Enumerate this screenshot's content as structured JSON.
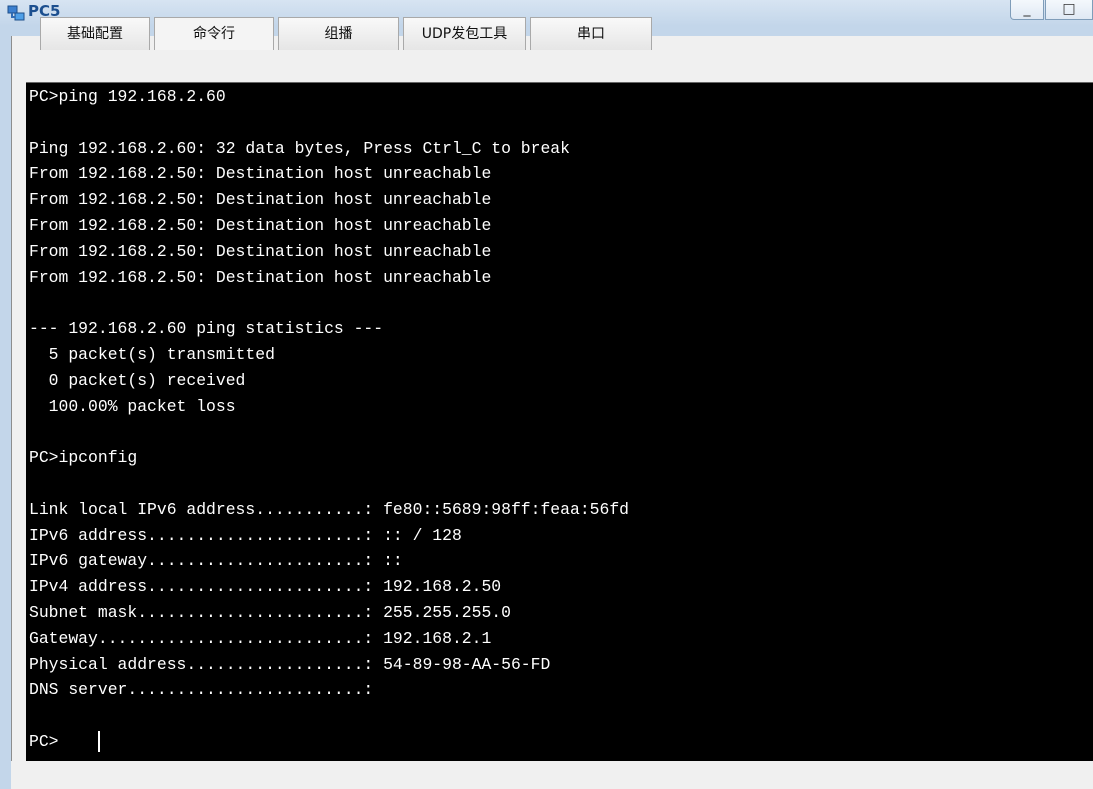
{
  "window": {
    "title": "PC5",
    "minimize_label": "_",
    "maximize_label": "□"
  },
  "tabs": [
    {
      "label": "基础配置"
    },
    {
      "label": "命令行"
    },
    {
      "label": "组播"
    },
    {
      "label": "UDP发包工具"
    },
    {
      "label": "串口"
    }
  ],
  "terminal": {
    "lines": [
      "PC>ping 192.168.2.60",
      "",
      "Ping 192.168.2.60: 32 data bytes, Press Ctrl_C to break",
      "From 192.168.2.50: Destination host unreachable",
      "From 192.168.2.50: Destination host unreachable",
      "From 192.168.2.50: Destination host unreachable",
      "From 192.168.2.50: Destination host unreachable",
      "From 192.168.2.50: Destination host unreachable",
      "",
      "--- 192.168.2.60 ping statistics ---",
      "  5 packet(s) transmitted",
      "  0 packet(s) received",
      "  100.00% packet loss",
      "",
      "PC>ipconfig",
      "",
      "Link local IPv6 address...........: fe80::5689:98ff:feaa:56fd",
      "IPv6 address......................: :: / 128",
      "IPv6 gateway......................: ::",
      "IPv4 address......................: 192.168.2.50",
      "Subnet mask.......................: 255.255.255.0",
      "Gateway...........................: 192.168.2.1",
      "Physical address..................: 54-89-98-AA-56-FD",
      "DNS server........................:",
      "",
      "PC>"
    ]
  },
  "colors": {
    "terminal_bg": "#000000",
    "terminal_fg": "#ffffff",
    "title_color": "#1c4f8f"
  }
}
